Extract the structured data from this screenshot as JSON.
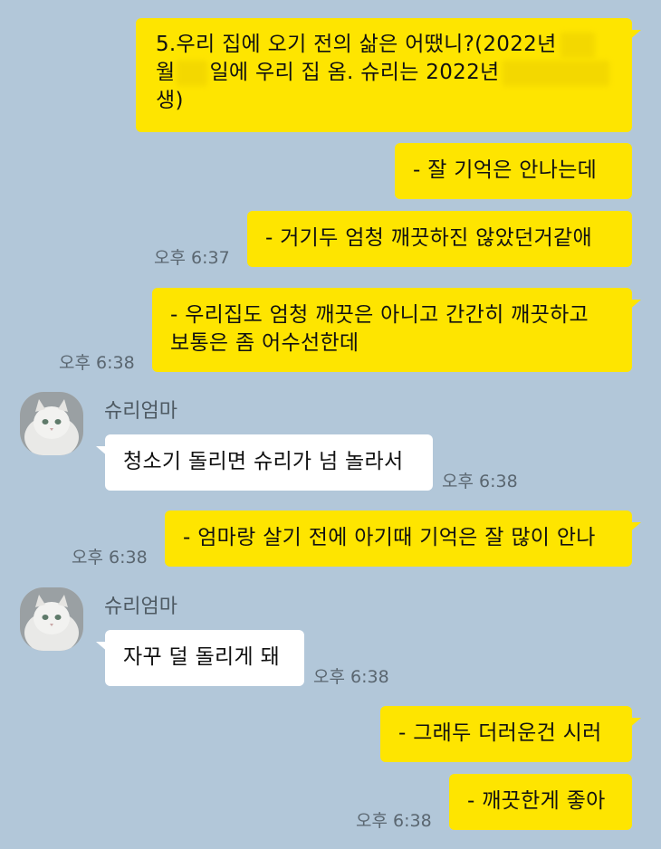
{
  "chat": {
    "sender_name": "슈리엄마",
    "messages": [
      {
        "side": "me",
        "line1": "5.우리 집에 오기 전의 삶은 어땠니?(2022년",
        "line2a": "월",
        "line2b": "일에 우리 집 옴. 슈리는 2022년",
        "line3": "생)"
      },
      {
        "side": "me",
        "text": "- 잘 기억은 안나는데"
      },
      {
        "side": "me",
        "text": "- 거기두 엄청 깨끗하진 않았던거같애",
        "time": "오후 6:37"
      },
      {
        "side": "me",
        "line1": "- 우리집도 엄청 깨끗은 아니고 간간히 깨끗하고",
        "line2": "보통은 좀 어수선한데",
        "time": "오후 6:38"
      },
      {
        "side": "other",
        "text": "청소기 돌리면 슈리가 넘 놀라서",
        "time": "오후 6:38"
      },
      {
        "side": "me",
        "text": "- 엄마랑 살기 전에 아기때 기억은 잘 많이 안나",
        "time": "오후 6:38"
      },
      {
        "side": "other",
        "text": "자꾸 덜 돌리게 돼",
        "time": "오후 6:38"
      },
      {
        "side": "me",
        "text": "- 그래두 더러운건 시러"
      },
      {
        "side": "me",
        "text": "- 깨끗한게 좋아",
        "time": "오후 6:38"
      }
    ]
  },
  "icons": {
    "avatar": "white-persian-cat-avatar"
  },
  "colors": {
    "background": "#b2c7d9",
    "my_bubble": "#fee500",
    "other_bubble": "#ffffff"
  }
}
